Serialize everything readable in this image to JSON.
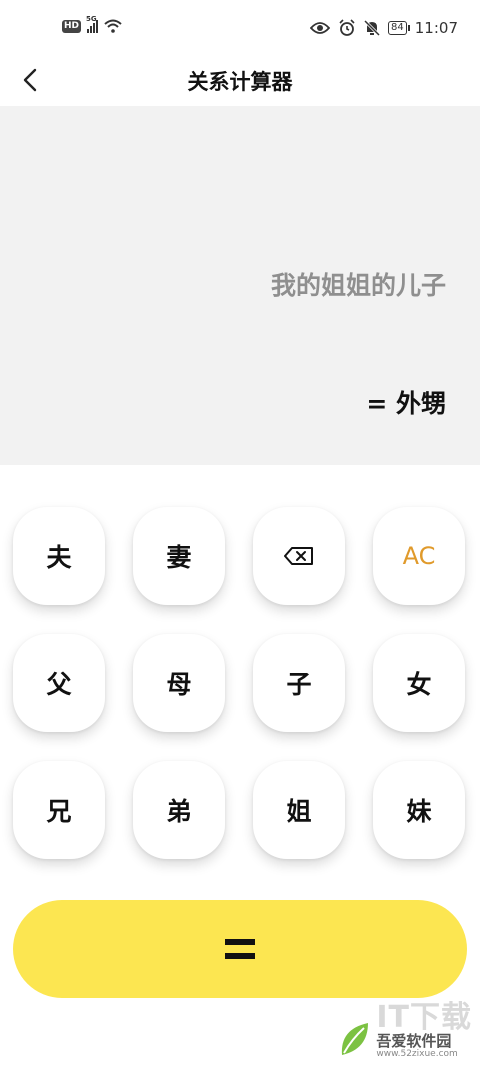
{
  "status_bar": {
    "hd": "HD",
    "network": "5G",
    "battery": "84",
    "time": "11:07"
  },
  "header": {
    "title": "关系计算器"
  },
  "display": {
    "expression": "我的姐姐的儿子",
    "result": "= 外甥"
  },
  "keypad": {
    "rows": [
      [
        "夫",
        "妻",
        "backspace-icon",
        "AC"
      ],
      [
        "父",
        "母",
        "子",
        "女"
      ],
      [
        "兄",
        "弟",
        "姐",
        "妹"
      ]
    ],
    "husband": "夫",
    "wife": "妻",
    "clear": "AC",
    "father": "父",
    "mother": "母",
    "son": "子",
    "daughter": "女",
    "elder_brother": "兄",
    "younger_brother": "弟",
    "elder_sister": "姐",
    "younger_sister": "妹"
  },
  "colors": {
    "display_bg": "#f2f2f2",
    "equals_bg": "#fce651",
    "ac_text": "#e09a2b",
    "expression_text": "#8f8f8f"
  },
  "watermark": {
    "big": "IT下载",
    "name": "吾爱软件园",
    "url": "www.52zixue.com"
  }
}
